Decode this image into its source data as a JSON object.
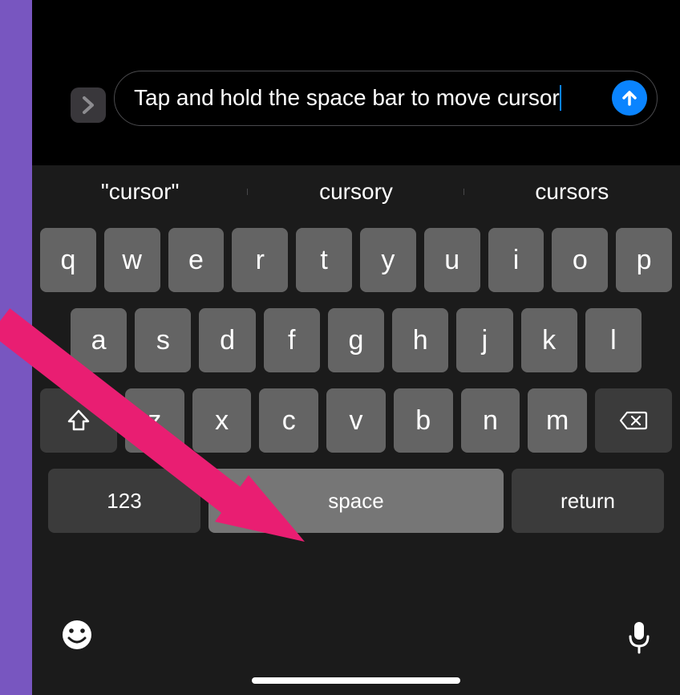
{
  "input": {
    "text": "Tap and hold the space bar to move cursor"
  },
  "suggestions": [
    "\"cursor\"",
    "cursory",
    "cursors"
  ],
  "keyboard": {
    "row1": [
      "q",
      "w",
      "e",
      "r",
      "t",
      "y",
      "u",
      "i",
      "o",
      "p"
    ],
    "row2": [
      "a",
      "s",
      "d",
      "f",
      "g",
      "h",
      "j",
      "k",
      "l"
    ],
    "row3": [
      "z",
      "x",
      "c",
      "v",
      "b",
      "n",
      "m"
    ],
    "numbers_label": "123",
    "space_label": "space",
    "return_label": "return"
  },
  "annotation": {
    "arrow_color": "#e91e72"
  }
}
